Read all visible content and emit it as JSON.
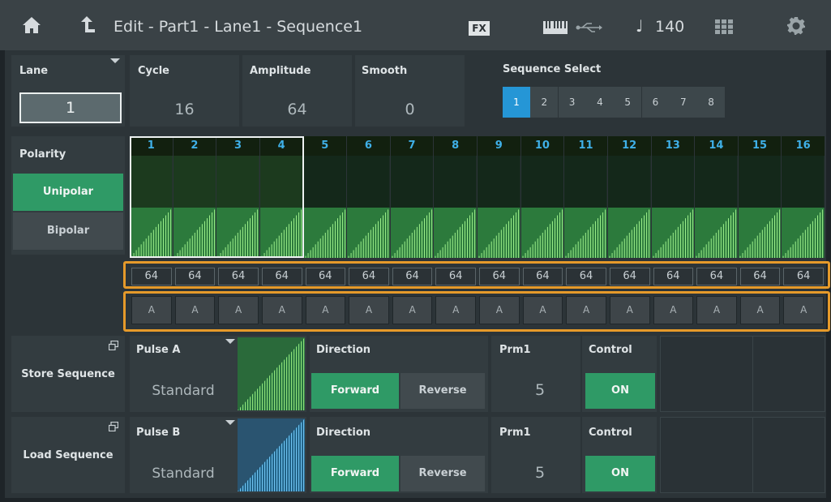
{
  "header": {
    "title": "Edit - Part1 - Lane1 - Sequence1",
    "fx": "FX",
    "note_glyph": "♩",
    "tempo": "140"
  },
  "lane": {
    "label": "Lane",
    "value": "1"
  },
  "cycle": {
    "label": "Cycle",
    "value": "16"
  },
  "amplitude": {
    "label": "Amplitude",
    "value": "64"
  },
  "smooth": {
    "label": "Smooth",
    "value": "0"
  },
  "sequence_select": {
    "label": "Sequence Select",
    "options": [
      "1",
      "2",
      "3",
      "4",
      "5",
      "6",
      "7",
      "8"
    ],
    "selected": "1"
  },
  "polarity": {
    "label": "Polarity",
    "unipolar": "Unipolar",
    "bipolar": "Bipolar",
    "selected": "Unipolar"
  },
  "steps": {
    "numbers": [
      "1",
      "2",
      "3",
      "4",
      "5",
      "6",
      "7",
      "8",
      "9",
      "10",
      "11",
      "12",
      "13",
      "14",
      "15",
      "16"
    ],
    "values": [
      "64",
      "64",
      "64",
      "64",
      "64",
      "64",
      "64",
      "64",
      "64",
      "64",
      "64",
      "64",
      "64",
      "64",
      "64",
      "64"
    ],
    "types": [
      "A",
      "A",
      "A",
      "A",
      "A",
      "A",
      "A",
      "A",
      "A",
      "A",
      "A",
      "A",
      "A",
      "A",
      "A",
      "A"
    ],
    "cursor_step": "4"
  },
  "store_sequence": {
    "label": "Store Sequence"
  },
  "load_sequence": {
    "label": "Load Sequence"
  },
  "pulse_a": {
    "label": "Pulse A",
    "value": "Standard",
    "direction_label": "Direction",
    "forward": "Forward",
    "reverse": "Reverse",
    "prm1_label": "Prm1",
    "prm1_value": "5",
    "control_label": "Control",
    "control_value": "ON"
  },
  "pulse_b": {
    "label": "Pulse B",
    "value": "Standard",
    "direction_label": "Direction",
    "forward": "Forward",
    "reverse": "Reverse",
    "prm1_label": "Prm1",
    "prm1_value": "5",
    "control_label": "Control",
    "control_value": "ON"
  },
  "colors": {
    "accent_blue": "#2596d6",
    "accent_green": "#2f9a66",
    "highlight_orange": "#e69a2a"
  }
}
